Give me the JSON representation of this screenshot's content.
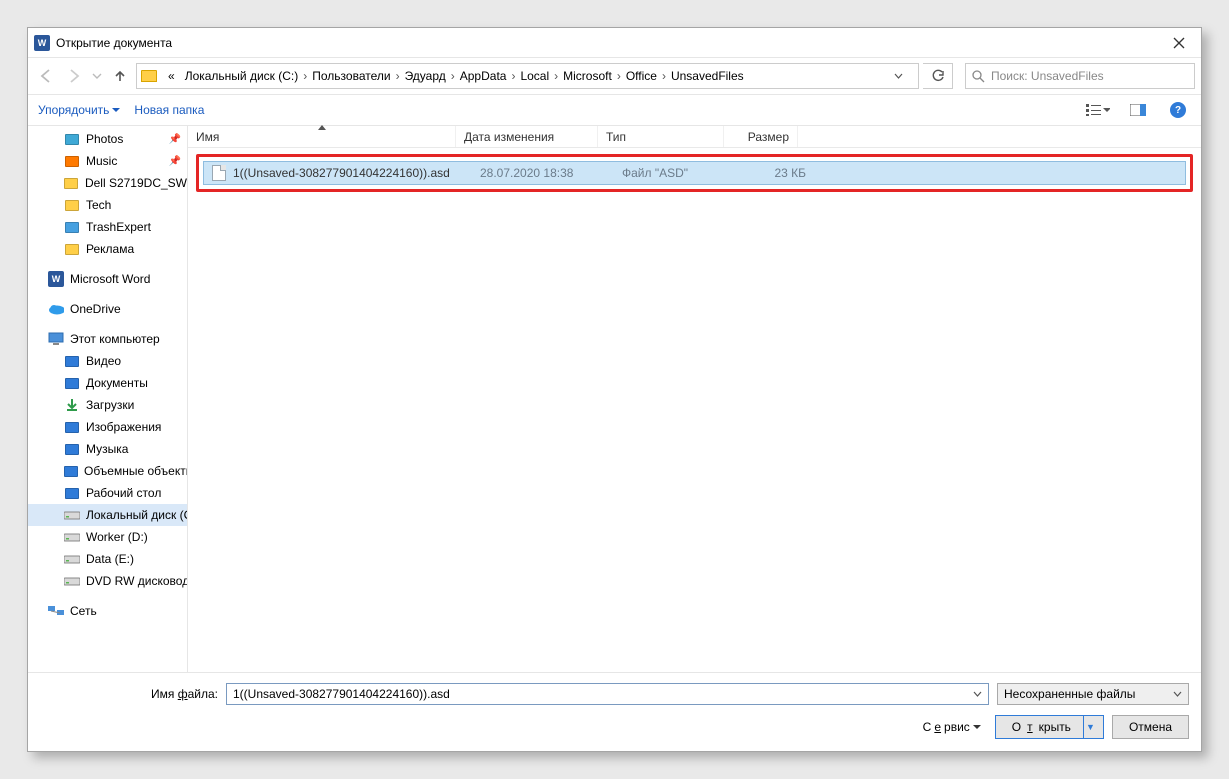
{
  "dialog": {
    "title": "Открытие документа"
  },
  "breadcrumbs": {
    "overflow": "«",
    "items": [
      "Локальный диск (C:)",
      "Пользователи",
      "Эдуард",
      "AppData",
      "Local",
      "Microsoft",
      "Office",
      "UnsavedFiles"
    ]
  },
  "search": {
    "placeholder": "Поиск: UnsavedFiles"
  },
  "command_bar": {
    "organize": "Упорядочить",
    "new_folder": "Новая папка"
  },
  "sidebar": {
    "quick": [
      {
        "label": "Photos",
        "pin": true,
        "icon": "photos"
      },
      {
        "label": "Music",
        "pin": true,
        "icon": "music"
      },
      {
        "label": "Dell S2719DC_SW",
        "pin": false,
        "icon": "folder"
      },
      {
        "label": "Tech",
        "pin": false,
        "icon": "folder"
      },
      {
        "label": "TrashExpert",
        "pin": false,
        "icon": "trash"
      },
      {
        "label": "Реклама",
        "pin": false,
        "icon": "folder"
      }
    ],
    "word": "Microsoft Word",
    "onedrive": "OneDrive",
    "this_pc": "Этот компьютер",
    "pc_items": [
      {
        "label": "Видео",
        "icon": "video"
      },
      {
        "label": "Документы",
        "icon": "docs"
      },
      {
        "label": "Загрузки",
        "icon": "downloads"
      },
      {
        "label": "Изображения",
        "icon": "pictures"
      },
      {
        "label": "Музыка",
        "icon": "music2"
      },
      {
        "label": "Объемные объекты",
        "icon": "3d"
      },
      {
        "label": "Рабочий стол",
        "icon": "desktop"
      },
      {
        "label": "Локальный диск (C:)",
        "icon": "drive",
        "selected": true
      },
      {
        "label": "Worker (D:)",
        "icon": "drive"
      },
      {
        "label": "Data (E:)",
        "icon": "drive"
      },
      {
        "label": "DVD RW дисковод",
        "icon": "dvd"
      }
    ],
    "network": "Сеть"
  },
  "columns": {
    "name": "Имя",
    "date": "Дата изменения",
    "type": "Тип",
    "size": "Размер"
  },
  "files": [
    {
      "name": "1((Unsaved-308277901404224160)).asd",
      "date": "28.07.2020 18:38",
      "type": "Файл \"ASD\"",
      "size": "23 КБ"
    }
  ],
  "footer": {
    "filename_label": "Имя файла:",
    "filename_value": "1((Unsaved-308277901404224160)).asd",
    "filetype": "Несохраненные файлы",
    "tools": "Сервис",
    "open": "Открыть",
    "cancel": "Отмена"
  }
}
